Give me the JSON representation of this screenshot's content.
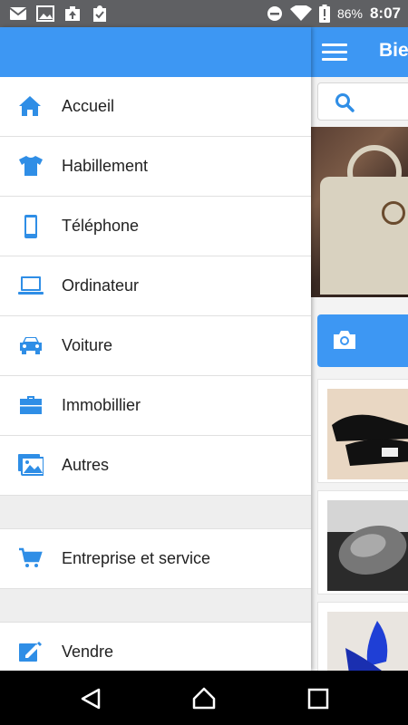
{
  "status_bar": {
    "battery_percent": "86%",
    "time": "8:07",
    "left_icons": [
      "mail-icon",
      "image-icon",
      "briefcase-upload-icon",
      "clipboard-check-icon"
    ],
    "right_icons": [
      "do-not-disturb-icon",
      "wifi-icon",
      "battery-icon"
    ]
  },
  "app": {
    "title_partial": "Bie",
    "menu_icon": "hamburger-icon",
    "search_icon": "search-icon",
    "camera_icon": "camera-icon"
  },
  "drawer": {
    "items": [
      {
        "label": "Accueil",
        "icon": "home-icon"
      },
      {
        "label": "Habillement",
        "icon": "tshirt-icon"
      },
      {
        "label": "Téléphone",
        "icon": "phone-icon"
      },
      {
        "label": "Ordinateur",
        "icon": "laptop-icon"
      },
      {
        "label": "Voiture",
        "icon": "car-icon"
      },
      {
        "label": "Immobillier",
        "icon": "briefcase-icon"
      },
      {
        "label": "Autres",
        "icon": "images-icon"
      }
    ],
    "section2": [
      {
        "label": "Entreprise et service",
        "icon": "cart-icon"
      }
    ],
    "section3": [
      {
        "label": "Vendre",
        "icon": "edit-icon"
      }
    ]
  },
  "colors": {
    "primary": "#3d97f3",
    "icon": "#2f8ee6",
    "status_bar": "#5f6063"
  },
  "navbar": {
    "buttons": [
      "back-icon",
      "home-nav-icon",
      "recents-icon"
    ]
  }
}
